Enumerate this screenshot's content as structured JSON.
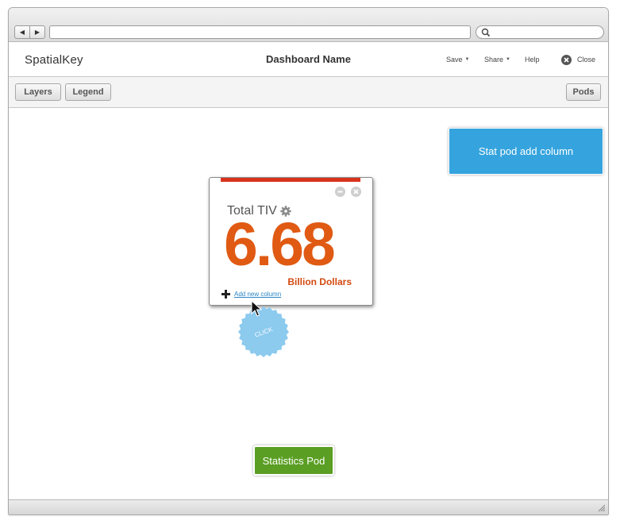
{
  "browser": {
    "back_icon": "triangle-left",
    "forward_icon": "triangle-right",
    "url_value": "",
    "search_value": "",
    "search_icon": "magnifier"
  },
  "app": {
    "logo": "SpatialKey",
    "title": "Dashboard Name",
    "menu": {
      "save": "Save",
      "share": "Share",
      "help": "Help",
      "close": "Close"
    }
  },
  "toolbar": {
    "layers": "Layers",
    "legend": "Legend",
    "pods": "Pods"
  },
  "stat_pod": {
    "title": "Total TIV",
    "value": "6.68",
    "unit": "Billion Dollars",
    "add_link": "Add new column",
    "accent_color": "#d9331d",
    "value_color": "#e05a13"
  },
  "annotations": {
    "click_label": "CLICK",
    "blue_note": "Stat pod add column",
    "green_note": "Statistics Pod",
    "blue_color": "#35a4de",
    "green_color": "#5a9e23"
  }
}
